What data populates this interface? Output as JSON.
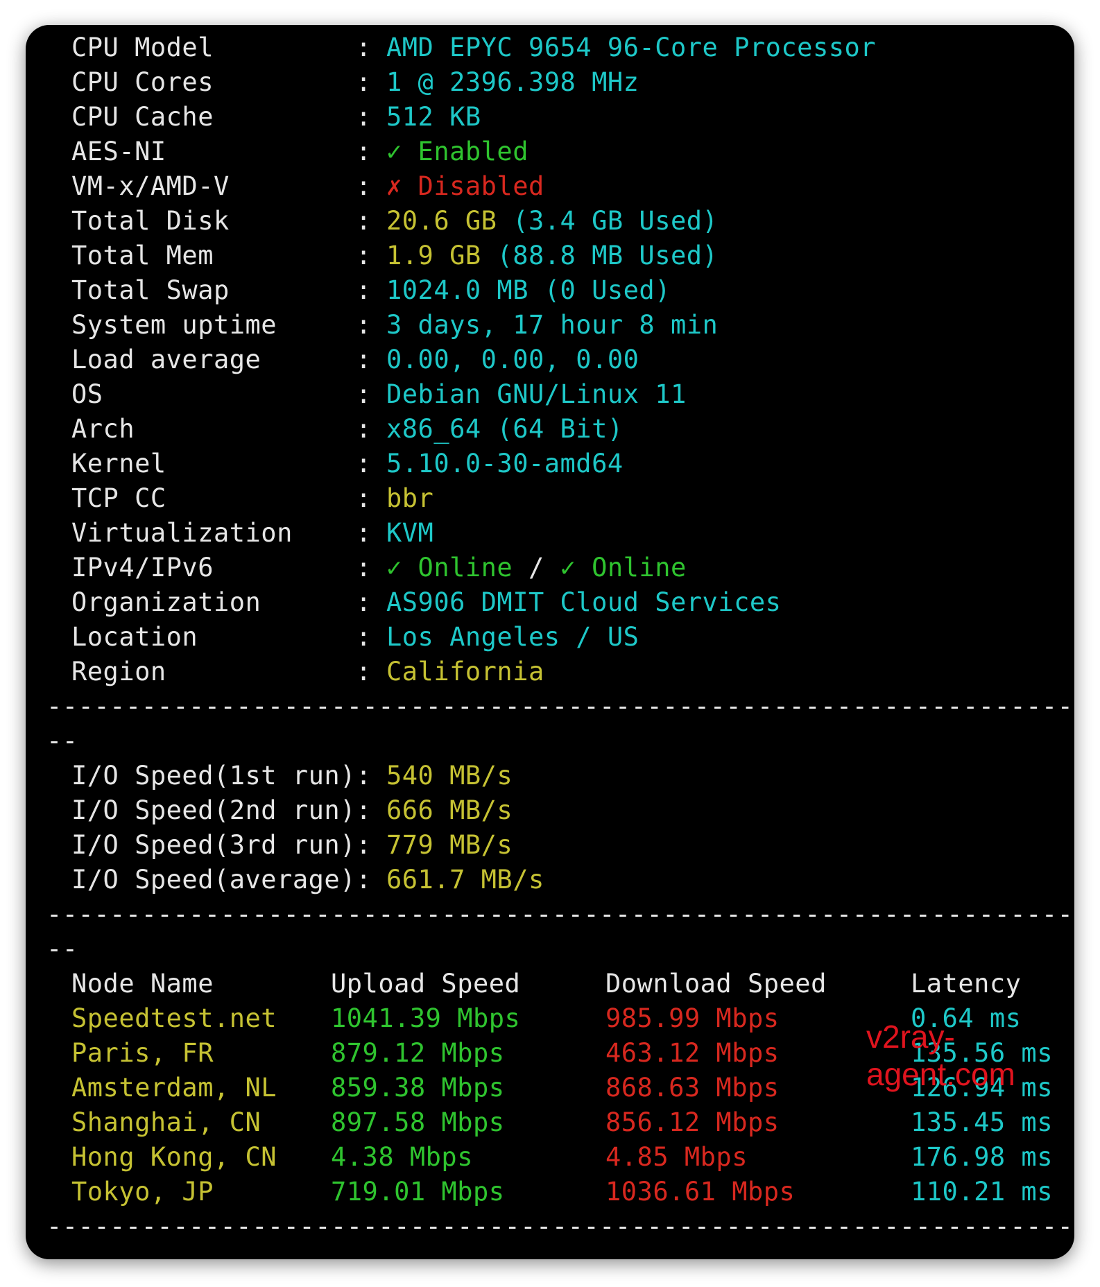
{
  "sysinfo": [
    {
      "label": "CPU Model",
      "value": "AMD EPYC 9654 96-Core Processor",
      "color": "cyan"
    },
    {
      "label": "CPU Cores",
      "value": "1 @ 2396.398 MHz",
      "color": "cyan"
    },
    {
      "label": "CPU Cache",
      "value": "512 KB",
      "color": "cyan"
    },
    {
      "label": "AES-NI",
      "value": "✓ Enabled",
      "color": "green"
    },
    {
      "label": "VM-x/AMD-V",
      "value": "✗ Disabled",
      "color": "red"
    },
    {
      "label": "Total Disk",
      "value_parts": [
        {
          "text": "20.6 GB ",
          "color": "yellow"
        },
        {
          "text": "(3.4 GB Used)",
          "color": "cyan"
        }
      ]
    },
    {
      "label": "Total Mem",
      "value_parts": [
        {
          "text": "1.9 GB ",
          "color": "yellow"
        },
        {
          "text": "(88.8 MB Used)",
          "color": "cyan"
        }
      ]
    },
    {
      "label": "Total Swap",
      "value": "1024.0 MB (0 Used)",
      "color": "cyan"
    },
    {
      "label": "System uptime",
      "value": "3 days, 17 hour 8 min",
      "color": "cyan"
    },
    {
      "label": "Load average",
      "value": "0.00, 0.00, 0.00",
      "color": "cyan"
    },
    {
      "label": "OS",
      "value": "Debian GNU/Linux 11",
      "color": "cyan"
    },
    {
      "label": "Arch",
      "value": "x86_64 (64 Bit)",
      "color": "cyan"
    },
    {
      "label": "Kernel",
      "value": "5.10.0-30-amd64",
      "color": "cyan"
    },
    {
      "label": "TCP CC",
      "value": "bbr",
      "color": "yellow"
    },
    {
      "label": "Virtualization",
      "value": "KVM",
      "color": "cyan"
    },
    {
      "label": "IPv4/IPv6",
      "value_parts": [
        {
          "text": "✓ Online",
          "color": "green"
        },
        {
          "text": " / ",
          "color": "white"
        },
        {
          "text": "✓ Online",
          "color": "green"
        }
      ]
    },
    {
      "label": "Organization",
      "value": "AS906 DMIT Cloud Services",
      "color": "cyan"
    },
    {
      "label": "Location",
      "value": "Los Angeles / US",
      "color": "cyan"
    },
    {
      "label": "Region",
      "value": "California",
      "color": "yellow"
    }
  ],
  "divider": "--------------------------------------------------------------------",
  "divider_tail": "--",
  "io": [
    {
      "label": "I/O Speed(1st run)",
      "value": "540 MB/s"
    },
    {
      "label": "I/O Speed(2nd run)",
      "value": "666 MB/s"
    },
    {
      "label": "I/O Speed(3rd run)",
      "value": "779 MB/s"
    },
    {
      "label": "I/O Speed(average)",
      "value": "661.7 MB/s"
    }
  ],
  "colon": ":",
  "speedtest": {
    "headers": [
      "Node Name",
      "Upload Speed",
      "Download Speed",
      "Latency"
    ],
    "rows": [
      {
        "node": "Speedtest.net",
        "upload": "1041.39 Mbps",
        "download": "985.99 Mbps",
        "latency": "0.64 ms"
      },
      {
        "node": "Paris, FR",
        "upload": "879.12 Mbps",
        "download": "463.12 Mbps",
        "latency": "135.56 ms"
      },
      {
        "node": "Amsterdam, NL",
        "upload": "859.38 Mbps",
        "download": "868.63 Mbps",
        "latency": "126.94 ms"
      },
      {
        "node": "Shanghai, CN",
        "upload": "897.58 Mbps",
        "download": "856.12 Mbps",
        "latency": "135.45 ms"
      },
      {
        "node": "Hong Kong, CN",
        "upload": "4.38 Mbps",
        "download": "4.85 Mbps",
        "latency": "176.98 ms"
      },
      {
        "node": "Tokyo, JP",
        "upload": "719.01 Mbps",
        "download": "1036.61 Mbps",
        "latency": "110.21 ms"
      }
    ]
  },
  "watermark": "v2ray-agent.com",
  "colors": {
    "cyan": "#1ec8c8",
    "yellow": "#c6c233",
    "green": "#2fc42f",
    "red": "#d8281f",
    "white": "#e6e6e6",
    "background": "#000000"
  }
}
